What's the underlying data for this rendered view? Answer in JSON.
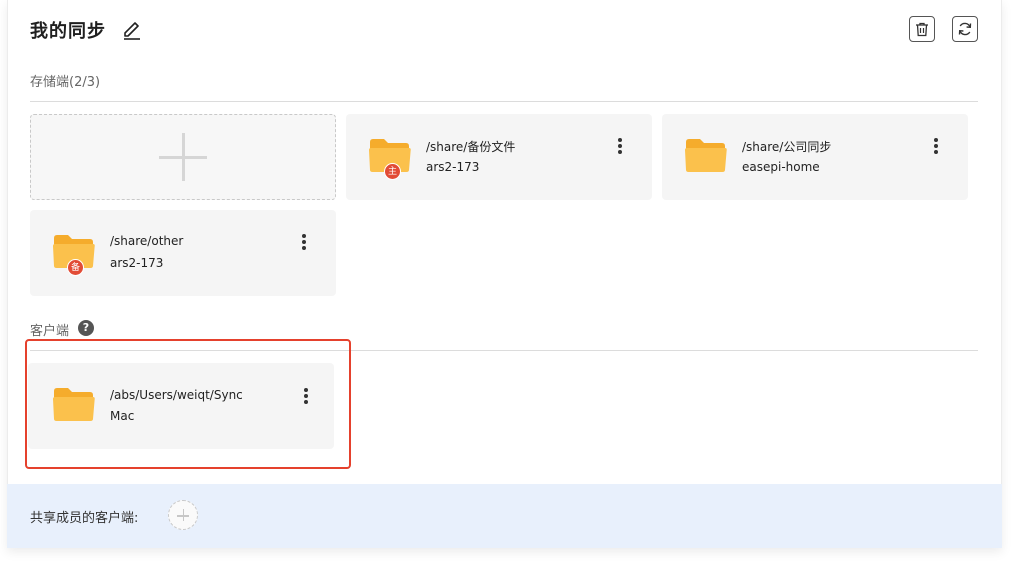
{
  "header": {
    "title": "我的同步",
    "edit_icon": "pencil-icon",
    "delete_icon": "trash-icon",
    "sync_icon": "refresh-icon"
  },
  "storage": {
    "label": "存储端(2/3)",
    "add_icon": "plus-icon",
    "items": [
      {
        "path": "/share/备份文件",
        "host": "ars2-173",
        "badge": "主",
        "folder_icon": "folder-icon"
      },
      {
        "path": "/share/公司同步",
        "host": "easepi-home",
        "badge": "",
        "folder_icon": "folder-icon"
      },
      {
        "path": "/share/other",
        "host": "ars2-173",
        "badge": "备",
        "folder_icon": "folder-icon"
      }
    ]
  },
  "clients": {
    "label": "客户端",
    "help_icon": "question-icon",
    "help_glyph": "?",
    "items": [
      {
        "path": "/abs/Users/weiqt/Sync",
        "host": "Mac",
        "folder_icon": "folder-icon"
      }
    ]
  },
  "footer": {
    "label": "共享成员的客户端:",
    "add_icon": "plus-icon"
  },
  "colors": {
    "folder": "#fbc14c",
    "folder_back": "#f5ac2c",
    "badge": "#e24c36",
    "highlight": "#e5412d",
    "footer_bg": "#e8f0fc"
  }
}
